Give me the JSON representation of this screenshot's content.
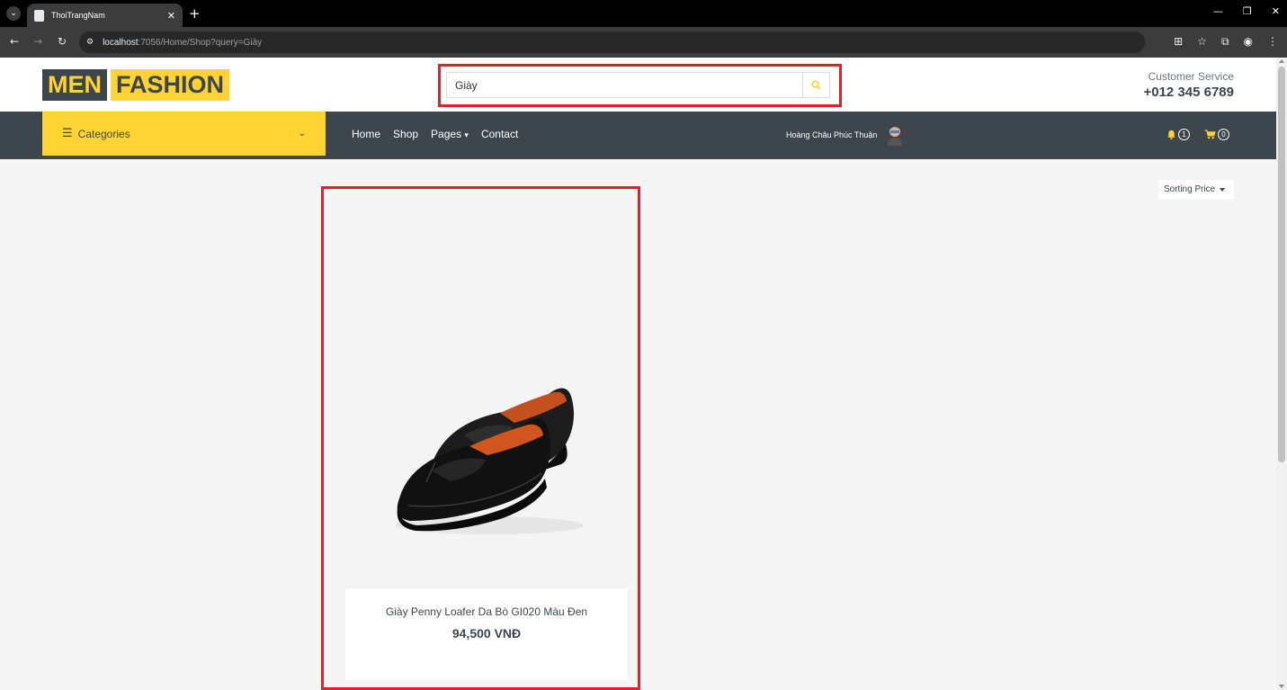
{
  "browser": {
    "tab_title": "ThoiTrangNam",
    "url_host": "localhost",
    "url_path": ":7056/Home/Shop?query=Giày"
  },
  "header": {
    "logo_part1": "MEN",
    "logo_part2": "FASHION",
    "search_value": "Giày",
    "customer_service_label": "Customer Service",
    "phone": "+012 345 6789"
  },
  "navbar": {
    "categories_label": "Categories",
    "links": [
      "Home",
      "Shop",
      "Pages",
      "Contact"
    ],
    "user_name": "Hoàng Châu Phúc Thuận",
    "notification_count": "1",
    "cart_count": "0"
  },
  "sorting": {
    "label": "Sorting Price"
  },
  "products": [
    {
      "name": "Giày Penny Loafer Da Bò GI020 Màu Đen",
      "price": "94,500 VNĐ"
    }
  ],
  "colors": {
    "accent": "#ffd333",
    "dark": "#3d464d",
    "highlight": "#e3202a"
  }
}
